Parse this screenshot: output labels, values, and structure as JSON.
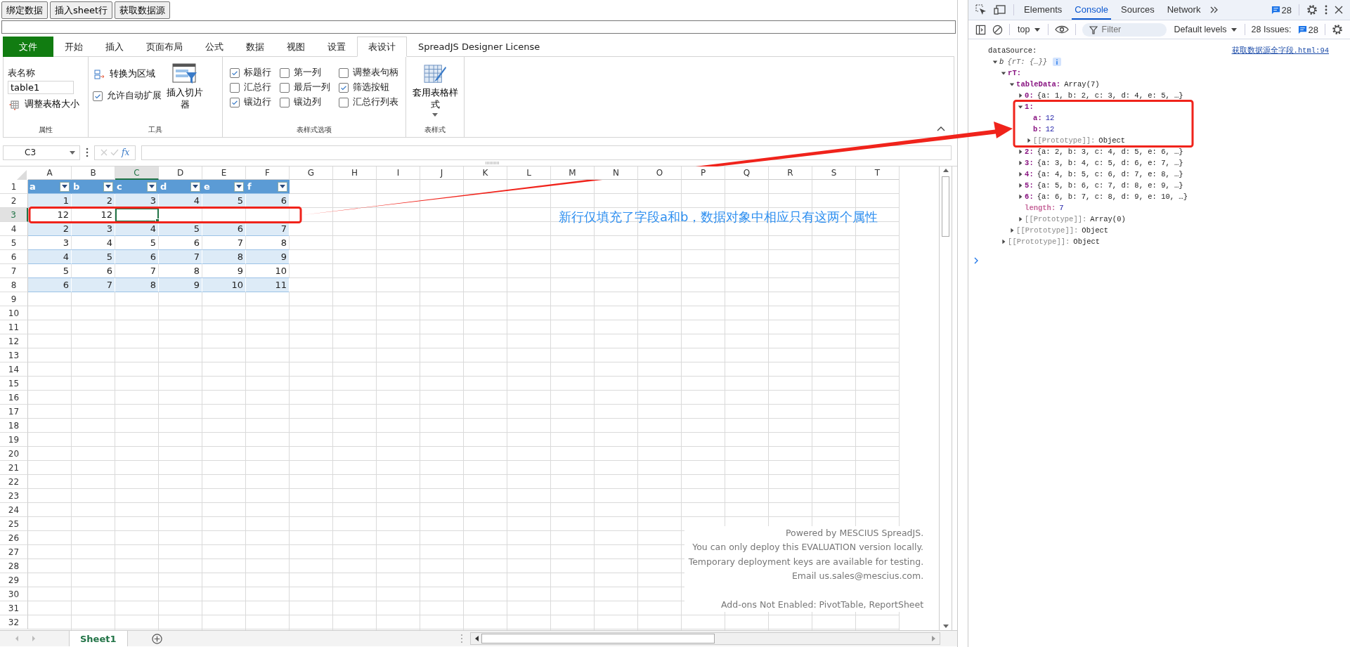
{
  "toolbar": {
    "buttons": [
      "绑定数据",
      "插入sheet行",
      "获取数据源"
    ]
  },
  "ribbon": {
    "tabs": [
      {
        "label": "文件",
        "kind": "file",
        "selected": false
      },
      {
        "label": "开始",
        "kind": "tab",
        "selected": false
      },
      {
        "label": "插入",
        "kind": "tab",
        "selected": false
      },
      {
        "label": "页面布局",
        "kind": "tab",
        "selected": false
      },
      {
        "label": "公式",
        "kind": "tab",
        "selected": false
      },
      {
        "label": "数据",
        "kind": "tab",
        "selected": false
      },
      {
        "label": "视图",
        "kind": "tab",
        "selected": false
      },
      {
        "label": "设置",
        "kind": "tab",
        "selected": false
      },
      {
        "label": "表设计",
        "kind": "tab",
        "selected": true
      },
      {
        "label": "SpreadJS Designer License",
        "kind": "tab",
        "selected": false
      }
    ],
    "groups": [
      {
        "kind": "name",
        "title": "属性",
        "field_label": "表名称",
        "field_value": "table1",
        "button": "调整表格大小"
      },
      {
        "kind": "tools",
        "title": "工具",
        "convert_button": "转换为区域",
        "auto_expand": {
          "label": "允许自动扩展",
          "checked": true
        },
        "slicer_button": "插入切片器"
      },
      {
        "kind": "options",
        "title": "表样式选项",
        "options": [
          {
            "label": "标题行",
            "checked": true
          },
          {
            "label": "汇总行",
            "checked": false
          },
          {
            "label": "镶边行",
            "checked": true
          },
          {
            "label": "第一列",
            "checked": false
          },
          {
            "label": "最后一列",
            "checked": false
          },
          {
            "label": "镶边列",
            "checked": false
          },
          {
            "label": "调整表句柄",
            "checked": false
          },
          {
            "label": "筛选按钮",
            "checked": true
          },
          {
            "label": "汇总行列表",
            "checked": false
          }
        ]
      },
      {
        "kind": "styles",
        "title": "表样式",
        "button": "套用表格样式"
      }
    ]
  },
  "formula_bar": {
    "name_box": "C3",
    "fx": "fx"
  },
  "grid": {
    "columns": [
      {
        "label": "A",
        "selected": false
      },
      {
        "label": "B",
        "selected": false
      },
      {
        "label": "C",
        "selected": true
      },
      {
        "label": "D",
        "selected": false
      },
      {
        "label": "E",
        "selected": false
      },
      {
        "label": "F",
        "selected": false
      },
      {
        "label": "G",
        "selected": false
      },
      {
        "label": "H",
        "selected": false
      },
      {
        "label": "I",
        "selected": false
      },
      {
        "label": "J",
        "selected": false
      },
      {
        "label": "K",
        "selected": false
      },
      {
        "label": "L",
        "selected": false
      },
      {
        "label": "M",
        "selected": false
      },
      {
        "label": "N",
        "selected": false
      },
      {
        "label": "O",
        "selected": false
      },
      {
        "label": "P",
        "selected": false
      },
      {
        "label": "Q",
        "selected": false
      },
      {
        "label": "R",
        "selected": false
      },
      {
        "label": "S",
        "selected": false
      },
      {
        "label": "T",
        "selected": false
      }
    ],
    "rows": [
      {
        "label": "1",
        "selected": false,
        "kind": "header",
        "cells": [
          {
            "value": "a",
            "selected": false
          },
          {
            "value": "b",
            "selected": false
          },
          {
            "value": "c",
            "selected": false
          },
          {
            "value": "d",
            "selected": false
          },
          {
            "value": "e",
            "selected": false
          },
          {
            "value": "f",
            "selected": false
          }
        ]
      },
      {
        "label": "2",
        "selected": false,
        "kind": "band",
        "cells": [
          {
            "value": "1",
            "selected": false
          },
          {
            "value": "2",
            "selected": false
          },
          {
            "value": "3",
            "selected": false
          },
          {
            "value": "4",
            "selected": false
          },
          {
            "value": "5",
            "selected": false
          },
          {
            "value": "6",
            "selected": false
          }
        ]
      },
      {
        "label": "3",
        "selected": true,
        "kind": "plain",
        "cells": [
          {
            "value": "12",
            "selected": false
          },
          {
            "value": "12",
            "selected": false
          },
          {
            "selected": true
          },
          {
            "selected": false
          },
          {
            "selected": false
          },
          {
            "selected": false
          }
        ]
      },
      {
        "label": "4",
        "selected": false,
        "kind": "band",
        "cells": [
          {
            "value": "2",
            "selected": false
          },
          {
            "value": "3",
            "selected": false
          },
          {
            "value": "4",
            "selected": false
          },
          {
            "value": "5",
            "selected": false
          },
          {
            "value": "6",
            "selected": false
          },
          {
            "value": "7",
            "selected": false
          }
        ]
      },
      {
        "label": "5",
        "selected": false,
        "kind": "plain",
        "cells": [
          {
            "value": "3",
            "selected": false
          },
          {
            "value": "4",
            "selected": false
          },
          {
            "value": "5",
            "selected": false
          },
          {
            "value": "6",
            "selected": false
          },
          {
            "value": "7",
            "selected": false
          },
          {
            "value": "8",
            "selected": false
          }
        ]
      },
      {
        "label": "6",
        "selected": false,
        "kind": "band",
        "cells": [
          {
            "value": "4",
            "selected": false
          },
          {
            "value": "5",
            "selected": false
          },
          {
            "value": "6",
            "selected": false
          },
          {
            "value": "7",
            "selected": false
          },
          {
            "value": "8",
            "selected": false
          },
          {
            "value": "9",
            "selected": false
          }
        ]
      },
      {
        "label": "7",
        "selected": false,
        "kind": "plain",
        "cells": [
          {
            "value": "5",
            "selected": false
          },
          {
            "value": "6",
            "selected": false
          },
          {
            "value": "7",
            "selected": false
          },
          {
            "value": "8",
            "selected": false
          },
          {
            "value": "9",
            "selected": false
          },
          {
            "value": "10",
            "selected": false
          }
        ]
      },
      {
        "label": "8",
        "selected": false,
        "kind": "band",
        "cells": [
          {
            "value": "6",
            "selected": false
          },
          {
            "value": "7",
            "selected": false
          },
          {
            "value": "8",
            "selected": false
          },
          {
            "value": "9",
            "selected": false
          },
          {
            "value": "10",
            "selected": false
          },
          {
            "value": "11",
            "selected": false
          }
        ]
      },
      {
        "label": "9",
        "selected": false
      },
      {
        "label": "10",
        "selected": false
      },
      {
        "label": "11",
        "selected": false
      },
      {
        "label": "12",
        "selected": false
      },
      {
        "label": "13",
        "selected": false
      },
      {
        "label": "14",
        "selected": false
      },
      {
        "label": "15",
        "selected": false
      },
      {
        "label": "16",
        "selected": false
      },
      {
        "label": "17",
        "selected": false
      },
      {
        "label": "18",
        "selected": false
      },
      {
        "label": "19",
        "selected": false
      },
      {
        "label": "20",
        "selected": false
      },
      {
        "label": "21",
        "selected": false
      },
      {
        "label": "22",
        "selected": false
      },
      {
        "label": "23",
        "selected": false
      },
      {
        "label": "24",
        "selected": false
      },
      {
        "label": "25",
        "selected": false
      },
      {
        "label": "26",
        "selected": false
      },
      {
        "label": "27",
        "selected": false
      },
      {
        "label": "28",
        "selected": false
      },
      {
        "label": "29",
        "selected": false
      },
      {
        "label": "30",
        "selected": false
      },
      {
        "label": "31",
        "selected": false
      },
      {
        "label": "32",
        "selected": false
      }
    ]
  },
  "notice": {
    "lines": [
      "Powered by MESCIUS SpreadJS.",
      "You can only deploy this EVALUATION version locally.",
      "Temporary deployment keys are available for testing.",
      "Email us.sales@mescius.com."
    ],
    "addons": "Add-ons Not Enabled: PivotTable, ReportSheet"
  },
  "sheet_tabs": [
    {
      "label": "Sheet1",
      "selected": true
    }
  ],
  "annotation": {
    "text": "新行仅填充了字段a和b，数据对象中相应只有这两个属性"
  },
  "devtools": {
    "tabs": [
      {
        "label": "Elements",
        "selected": false
      },
      {
        "label": "Console",
        "selected": true
      },
      {
        "label": "Sources",
        "selected": false
      },
      {
        "label": "Network",
        "selected": false
      }
    ],
    "message_count": "28",
    "context": "top",
    "filter_placeholder": "Filter",
    "levels": "Default levels",
    "issues_label": "28 Issues:",
    "issues_count": "28",
    "log": {
      "label": "dataSource:",
      "source": "获取数据源全字段.html:94",
      "tree": {
        "key": "b",
        "value": "{rT: {…}}",
        "kind": "root",
        "expanded": true,
        "children": [
          {
            "key": "rT:",
            "kind": "node",
            "expanded": true,
            "children": [
              {
                "key": "tableData:",
                "value": "Array(7)",
                "kind": "node",
                "expanded": true,
                "children": [
                  {
                    "key": "0:",
                    "value": "{a: 1, b: 2, c: 3, d: 4, e: 5, …}",
                    "kind": "node",
                    "expanded": false
                  },
                  {
                    "key": "1:",
                    "kind": "node",
                    "expanded": true,
                    "children": [
                      {
                        "key": "a:",
                        "value": "12",
                        "kind": "leaf"
                      },
                      {
                        "key": "b:",
                        "value": "12",
                        "kind": "leaf"
                      },
                      {
                        "key": "[[Prototype]]:",
                        "value": "Object",
                        "kind": "internal",
                        "expanded": false
                      }
                    ]
                  },
                  {
                    "key": "2:",
                    "value": "{a: 2, b: 3, c: 4, d: 5, e: 6, …}",
                    "kind": "node",
                    "expanded": false
                  },
                  {
                    "key": "3:",
                    "value": "{a: 3, b: 4, c: 5, d: 6, e: 7, …}",
                    "kind": "node",
                    "expanded": false
                  },
                  {
                    "key": "4:",
                    "value": "{a: 4, b: 5, c: 6, d: 7, e: 8, …}",
                    "kind": "node",
                    "expanded": false
                  },
                  {
                    "key": "5:",
                    "value": "{a: 5, b: 6, c: 7, d: 8, e: 9, …}",
                    "kind": "node",
                    "expanded": false
                  },
                  {
                    "key": "6:",
                    "value": "{a: 6, b: 7, c: 8, d: 9, e: 10, …}",
                    "kind": "node",
                    "expanded": false
                  },
                  {
                    "key": "length:",
                    "value": "7",
                    "kind": "hidden"
                  },
                  {
                    "key": "[[Prototype]]:",
                    "value": "Array(0)",
                    "kind": "internal",
                    "expanded": false
                  }
                ]
              },
              {
                "key": "[[Prototype]]:",
                "value": "Object",
                "kind": "internal",
                "expanded": false
              }
            ]
          },
          {
            "key": "[[Prototype]]:",
            "value": "Object",
            "kind": "internal",
            "expanded": false
          }
        ]
      }
    }
  }
}
